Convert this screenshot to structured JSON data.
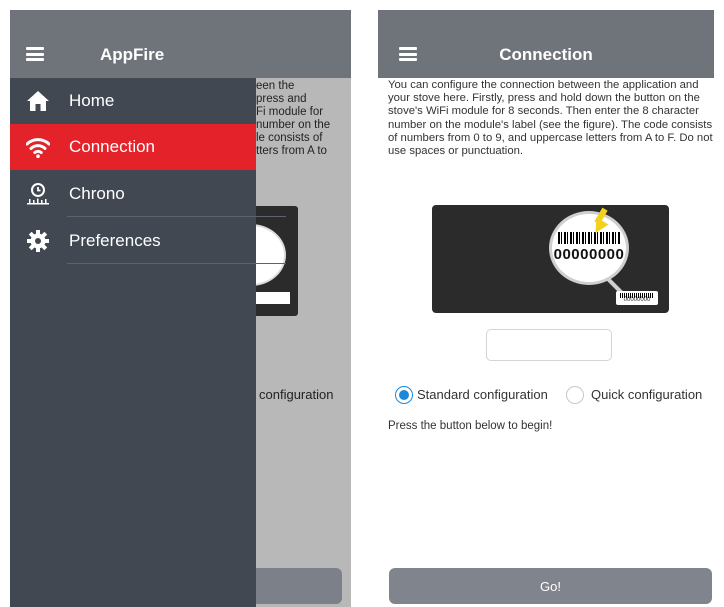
{
  "drawer_screen": {
    "app_title": "AppFire",
    "menu": [
      {
        "label": "Home",
        "icon": "home-icon",
        "active": false
      },
      {
        "label": "Connection",
        "icon": "wifi-icon",
        "active": true
      },
      {
        "label": "Chrono",
        "icon": "chrono-icon",
        "active": false
      },
      {
        "label": "Preferences",
        "icon": "gear-icon",
        "active": false
      }
    ],
    "background": {
      "text_lines": [
        "een the",
        " press and",
        "Fi module for",
        "number on the",
        "le consists of",
        "tters from A to"
      ],
      "config_text": "configuration"
    }
  },
  "connection_screen": {
    "title": "Connection",
    "intro": "You can configure the connection between the application and your stove here. Firstly, press and hold down the button on the stove's WiFi module for 8 seconds. Then enter the 8 character number on the module's label (see the figure). The code consists of numbers from 0 to 9, and uppercase letters from A to F. Do not use spaces or punctuation.",
    "figure_code": "00000000",
    "figure_small_code": "00000000",
    "code_input_value": "",
    "options": [
      {
        "label": "Standard configuration",
        "selected": true
      },
      {
        "label": "Quick configuration",
        "selected": false
      }
    ],
    "begin_text": "Press the button below to begin!",
    "go_label": "Go!"
  },
  "colors": {
    "header": "#6f737a",
    "drawer": "#414852",
    "active": "#e3222a",
    "accent": "#1e88d8",
    "button": "#80848c"
  }
}
